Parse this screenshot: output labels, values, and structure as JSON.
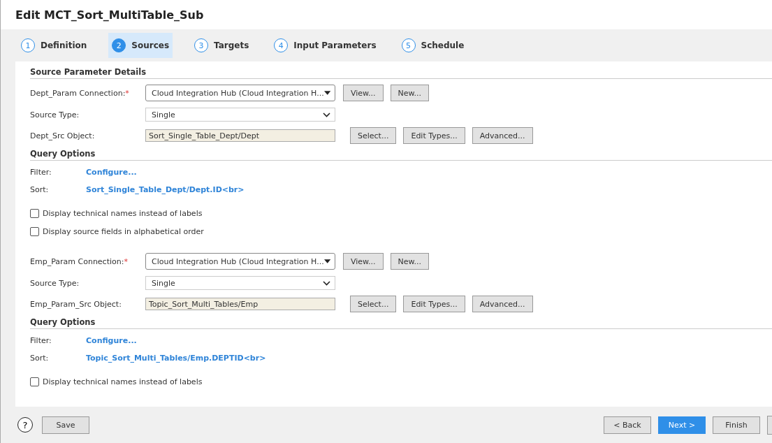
{
  "window": {
    "title": "Edit MCT_Sort_MultiTable_Sub"
  },
  "steps": [
    {
      "number": "1",
      "label": "Definition",
      "selected": false
    },
    {
      "number": "2",
      "label": "Sources",
      "selected": true
    },
    {
      "number": "3",
      "label": "Targets",
      "selected": false
    },
    {
      "number": "4",
      "label": "Input Parameters",
      "selected": false
    },
    {
      "number": "5",
      "label": "Schedule",
      "selected": false
    }
  ],
  "sources": [
    {
      "heading": "Source Parameter Details",
      "connection": {
        "label": "Dept_Param Connection:",
        "required_mark": "*",
        "value": "Cloud Integration Hub (Cloud Integration H...",
        "buttons": [
          "View...",
          "New..."
        ]
      },
      "source_type": {
        "label": "Source Type:",
        "value": "Single"
      },
      "object": {
        "label": "Dept_Src Object:",
        "value": "Sort_Single_Table_Dept/Dept",
        "buttons": [
          "Select...",
          "Edit Types...",
          "Advanced..."
        ]
      },
      "query_heading": "Query Options",
      "filter": {
        "label": "Filter:",
        "link": "Configure..."
      },
      "sort": {
        "label": "Sort:",
        "link": "Sort_Single_Table_Dept/Dept.ID<br>"
      },
      "checkboxes": [
        {
          "label": "Display technical names instead of labels",
          "checked": false
        },
        {
          "label": "Display source fields in alphabetical order",
          "checked": false
        }
      ]
    },
    {
      "connection": {
        "label": "Emp_Param Connection:",
        "required_mark": "*",
        "value": "Cloud Integration Hub (Cloud Integration H...",
        "buttons": [
          "View...",
          "New..."
        ]
      },
      "source_type": {
        "label": "Source Type:",
        "value": "Single"
      },
      "object": {
        "label": "Emp_Param_Src Object:",
        "value": "Topic_Sort_Multi_Tables/Emp",
        "buttons": [
          "Select...",
          "Edit Types...",
          "Advanced..."
        ]
      },
      "query_heading": "Query Options",
      "filter": {
        "label": "Filter:",
        "link": "Configure..."
      },
      "sort": {
        "label": "Sort:",
        "link": "Topic_Sort_Multi_Tables/Emp.DEPTID<br>"
      },
      "checkboxes": [
        {
          "label": "Display technical names instead of labels",
          "checked": false
        }
      ]
    }
  ],
  "footer": {
    "help": "?",
    "left_buttons": [
      {
        "label": "Save",
        "primary": false
      }
    ],
    "right_buttons": [
      {
        "label": "< Back",
        "primary": false
      },
      {
        "label": "Next >",
        "primary": true
      },
      {
        "label": "Finish",
        "primary": false
      }
    ]
  }
}
